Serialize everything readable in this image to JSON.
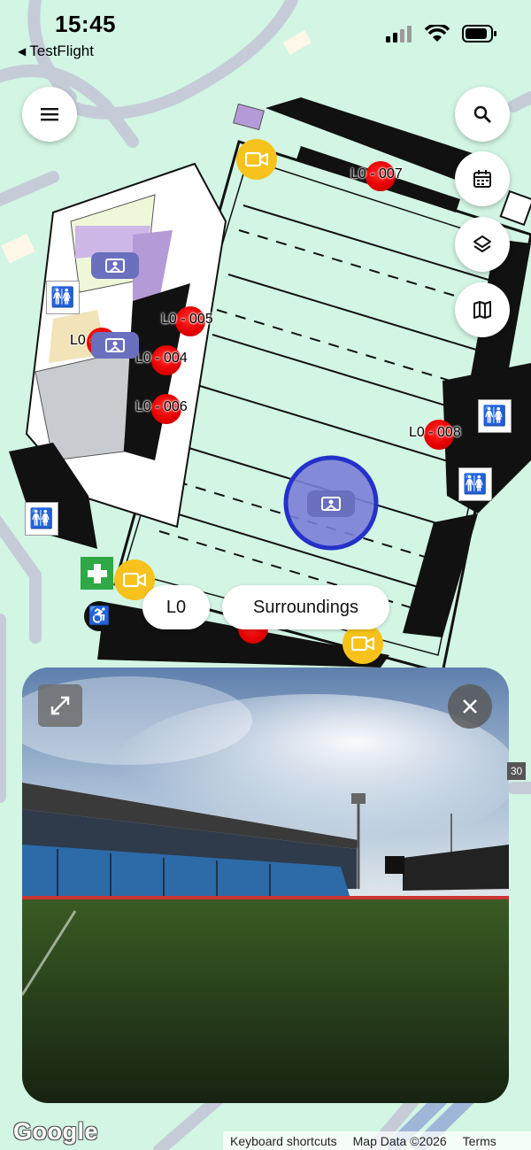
{
  "status_bar": {
    "time": "15:45",
    "back_label": "TestFlight",
    "icons": [
      "cellular-signal-icon",
      "wifi-icon",
      "battery-icon"
    ]
  },
  "toolbar": {
    "menu_icon": "hamburger-icon",
    "search_icon": "search-icon",
    "calendar_icon": "calendar-icon",
    "layers_icon": "layers-icon",
    "map_icon": "map-icon"
  },
  "markers": [
    {
      "id": "L0 - 007"
    },
    {
      "id": "L0 - 005"
    },
    {
      "id": "L0 - 002"
    },
    {
      "id": "L0 - 004"
    },
    {
      "id": "L0 - 006"
    },
    {
      "id": "L0 - 008"
    }
  ],
  "floor_selector": {
    "current": "L0",
    "surroundings": "Surroundings"
  },
  "street_view": {
    "expand_icon": "expand-icon",
    "close_icon": "close-icon"
  },
  "side_badge": "30",
  "attribution": {
    "logo": "Google",
    "keyboard_shortcuts": "Keyboard shortcuts",
    "map_data": "Map Data ©2026",
    "terms": "Terms"
  },
  "colors": {
    "map_background": "#d2f5e4",
    "marker_red": "#e60000",
    "camera_yellow": "#f6c21b",
    "first_aid_green": "#2fa845",
    "location_blue": "#2431c9"
  }
}
